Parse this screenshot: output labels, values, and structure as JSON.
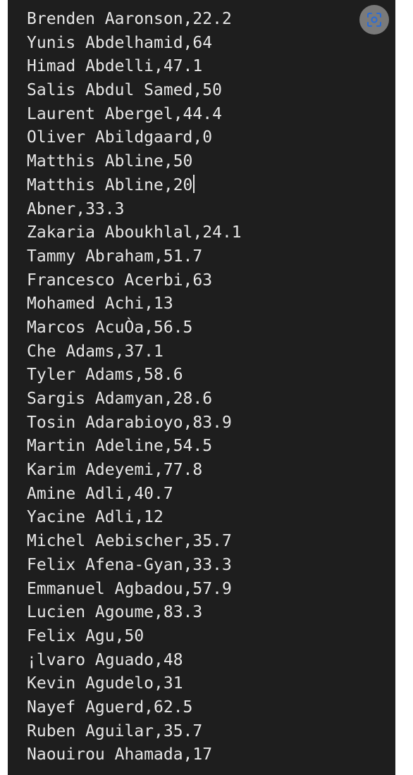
{
  "editor": {
    "lines": [
      "Brenden Aaronson,22.2",
      "Yunis Abdelhamid,64",
      "Himad Abdelli,47.1",
      "Salis Abdul Samed,50",
      "Laurent Abergel,44.4",
      "Oliver Abildgaard,0",
      "Matthis Abline,50",
      "Matthis Abline,20",
      "Abner,33.3",
      "Zakaria Aboukhlal,24.1",
      "Tammy Abraham,51.7",
      "Francesco Acerbi,63",
      "Mohamed Achi,13",
      "Marcos AcuÒa,56.5",
      "Che Adams,37.1",
      "Tyler Adams,58.6",
      "Sargis Adamyan,28.6",
      "Tosin Adarabioyo,83.9",
      "Martin Adeline,54.5",
      "Karim Adeyemi,77.8",
      "Amine Adli,40.7",
      "Yacine Adli,12",
      "Michel Aebischer,35.7",
      "Felix Afena-Gyan,33.3",
      "Emmanuel Agbadou,57.9",
      "Lucien Agoume,83.3",
      "Felix Agu,50",
      "¡lvaro Aguado,48",
      "Kevin Agudelo,31",
      "Nayef Aguerd,62.5",
      "Ruben Aguilar,35.7",
      "Naouirou Ahamada,17"
    ],
    "cursor_line_index": 7
  },
  "overlay": {
    "icon": "google-lens-icon",
    "color": "#7a7a7a"
  }
}
